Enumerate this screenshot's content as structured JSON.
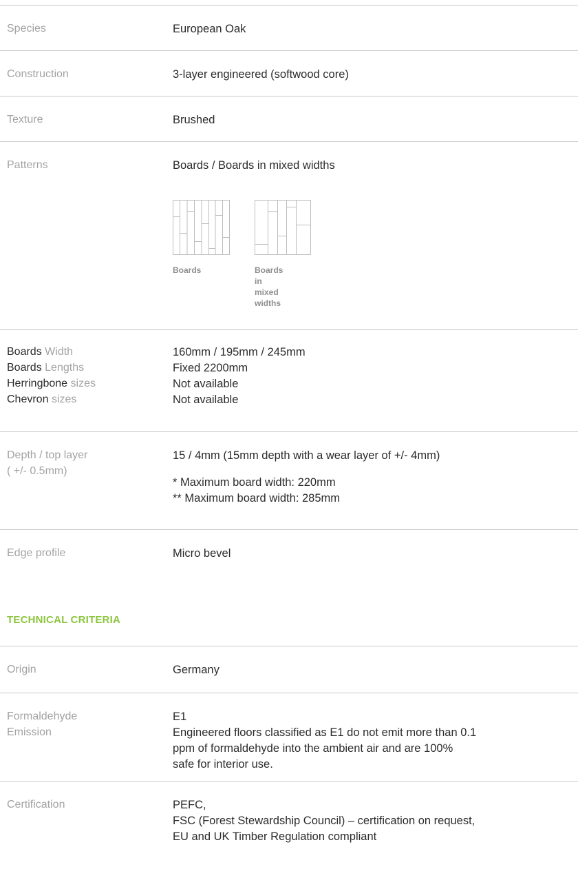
{
  "specs": {
    "species": {
      "label": "Species",
      "value": "European Oak"
    },
    "construction": {
      "label": "Construction",
      "value": "3-layer engineered (softwood core)"
    },
    "texture": {
      "label": "Texture",
      "value": "Brushed"
    },
    "patterns": {
      "label": "Patterns",
      "value": "Boards / Boards in mixed widths",
      "items": [
        {
          "caption": "Boards"
        },
        {
          "caption_lines": [
            "Boards",
            "in",
            "mixed",
            "widths"
          ]
        }
      ]
    },
    "dimensions": {
      "rows": [
        {
          "label_strong": "Boards",
          "label_muted": "Width",
          "value": "160mm / 195mm / 245mm"
        },
        {
          "label_strong": "Boards",
          "label_muted": "Lengths",
          "value": "Fixed 2200mm"
        },
        {
          "label_strong": "Herringbone",
          "label_muted": "sizes",
          "value": "Not available"
        },
        {
          "label_strong": "Chevron",
          "label_muted": "sizes",
          "value": "Not available"
        }
      ]
    },
    "depth": {
      "label_line1": "Depth / top layer",
      "label_line2": "( +/- 0.5mm)",
      "value": "15 / 4mm (15mm depth with a wear layer of +/- 4mm)",
      "notes": [
        "* Maximum board width: 220mm",
        "** Maximum board width: 285mm"
      ]
    },
    "edge": {
      "label": "Edge profile",
      "value": "Micro bevel"
    }
  },
  "technical": {
    "title": "TECHNICAL CRITERIA",
    "title_color": "#8cc63f",
    "origin": {
      "label": "Origin",
      "value": "Germany"
    },
    "formaldehyde": {
      "label_line1": "Formaldehyde",
      "label_line2": "Emission",
      "value": "E1",
      "desc_lines": [
        "Engineered floors classified as E1 do not emit more than 0.1",
        "ppm of formaldehyde into the ambient air and are 100%",
        "safe for interior use."
      ]
    },
    "certification": {
      "label": "Certification",
      "lines": [
        "PEFC,",
        "FSC (Forest Stewardship Council) – certification on request,",
        "EU and UK Timber Regulation compliant"
      ]
    }
  }
}
